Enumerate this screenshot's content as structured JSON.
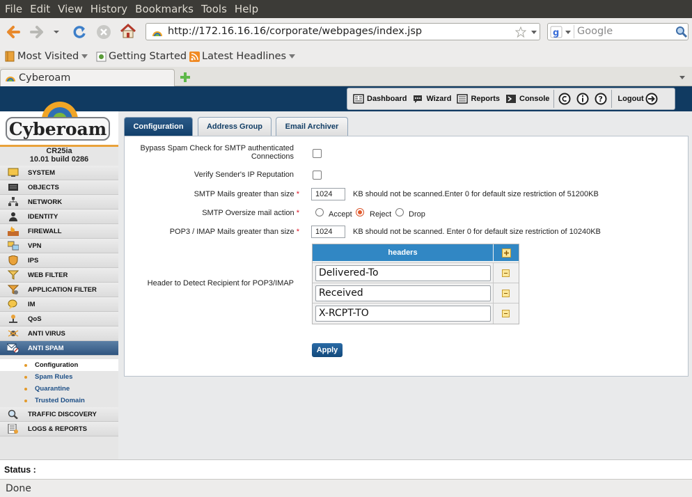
{
  "menubar": [
    "File",
    "Edit",
    "View",
    "History",
    "Bookmarks",
    "Tools",
    "Help"
  ],
  "navbar": {
    "url": "http://172.16.16.16/corporate/webpages/index.jsp",
    "search_placeholder": "Google"
  },
  "bookmarks": [
    "Most Visited",
    "Getting Started",
    "Latest Headlines"
  ],
  "browser_tab": {
    "title": "Cyberoam"
  },
  "toolbar": {
    "dashboard": "Dashboard",
    "wizard": "Wizard",
    "reports": "Reports",
    "console": "Console",
    "logout": "Logout"
  },
  "logo": {
    "text": "Cyberoam"
  },
  "device": {
    "model": "CR25ia",
    "build": "10.01 build 0286"
  },
  "sidebar": {
    "items": [
      {
        "label": "SYSTEM",
        "icon": "monitor-icon"
      },
      {
        "label": "OBJECTS",
        "icon": "objects-icon"
      },
      {
        "label": "NETWORK",
        "icon": "network-icon"
      },
      {
        "label": "IDENTITY",
        "icon": "identity-icon"
      },
      {
        "label": "FIREWALL",
        "icon": "firewall-icon"
      },
      {
        "label": "VPN",
        "icon": "vpn-icon"
      },
      {
        "label": "IPS",
        "icon": "shield-icon"
      },
      {
        "label": "WEB FILTER",
        "icon": "filter-icon"
      },
      {
        "label": "APPLICATION FILTER",
        "icon": "app-filter-icon"
      },
      {
        "label": "IM",
        "icon": "im-icon"
      },
      {
        "label": "QoS",
        "icon": "qos-icon"
      },
      {
        "label": "ANTI VIRUS",
        "icon": "antivirus-icon"
      },
      {
        "label": "ANTI SPAM",
        "icon": "antispam-icon"
      }
    ],
    "subitems": [
      "Configuration",
      "Spam Rules",
      "Quarantine",
      "Trusted Domain"
    ],
    "bottom_items": [
      {
        "label": "TRAFFIC DISCOVERY",
        "icon": "magnifier-icon"
      },
      {
        "label": "LOGS & REPORTS",
        "icon": "logs-icon"
      }
    ]
  },
  "tabs": [
    "Configuration",
    "Address Group",
    "Email Archiver"
  ],
  "form": {
    "bypass_label_1": "Bypass Spam Check for SMTP authenticated",
    "bypass_label_2": "Connections",
    "verify_label": "Verify Sender's IP Reputation",
    "smtp_size_label": "SMTP Mails greater than size",
    "smtp_size_value": "1024",
    "smtp_size_hint": "KB should not be scanned.Enter 0 for default size restriction of 51200KB",
    "oversize_label": "SMTP Oversize mail action",
    "oversize_options": [
      "Accept",
      "Reject",
      "Drop"
    ],
    "oversize_selected": "Reject",
    "pop3_size_label": "POP3 / IMAP Mails greater than size",
    "pop3_size_value": "1024",
    "pop3_size_hint": "KB should not be scanned. Enter 0 for default size restriction of 10240KB",
    "header_label": "Header to Detect Recipient for POP3/IMAP",
    "headers_column": "headers",
    "headers": [
      "Delivered-To",
      "Received",
      "X-RCPT-TO"
    ],
    "required_mark": "*",
    "apply_label": "Apply"
  },
  "status": {
    "label": "Status :",
    "browser": "Done"
  }
}
